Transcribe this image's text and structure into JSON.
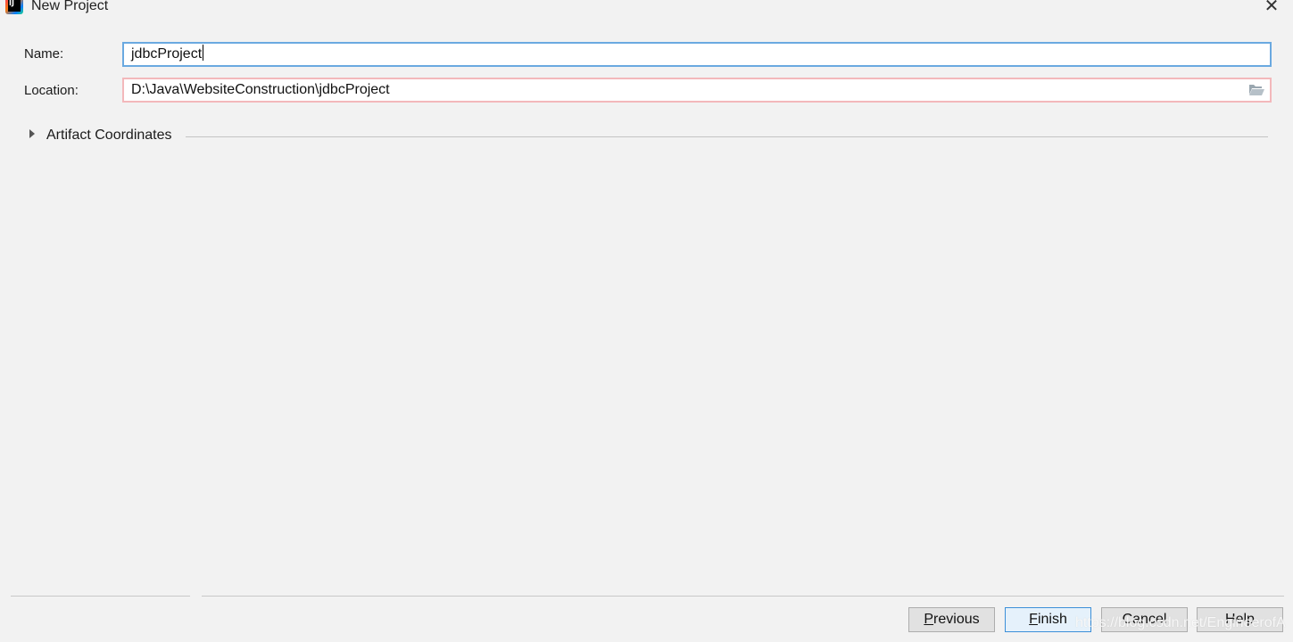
{
  "window": {
    "title": "New Project",
    "app_icon": "intellij-idea-icon",
    "app_icon_text": "IJ",
    "close_glyph": "✕"
  },
  "form": {
    "name_label": "Name:",
    "name_value": "jdbcProject",
    "location_label": "Location:",
    "location_value": "D:\\Java\\WebsiteConstruction\\jdbcProject",
    "location_browse_icon": "folder-open-icon"
  },
  "section": {
    "expander_icon": "triangle-right-icon",
    "title": "Artifact Coordinates",
    "expanded": false
  },
  "buttons": {
    "previous": {
      "mnemonic": "P",
      "rest": "revious"
    },
    "finish": {
      "mnemonic": "F",
      "rest": "inish"
    },
    "cancel": {
      "label": "Cancel"
    },
    "help": {
      "label": "Help"
    }
  },
  "watermark": "https://blog.csdn.net/EngineerofA",
  "colors": {
    "background": "#f2f2f2",
    "focus_border": "#6aa9e0",
    "error_border": "#f3b8bb",
    "primary_button_border": "#3c8fd8"
  }
}
